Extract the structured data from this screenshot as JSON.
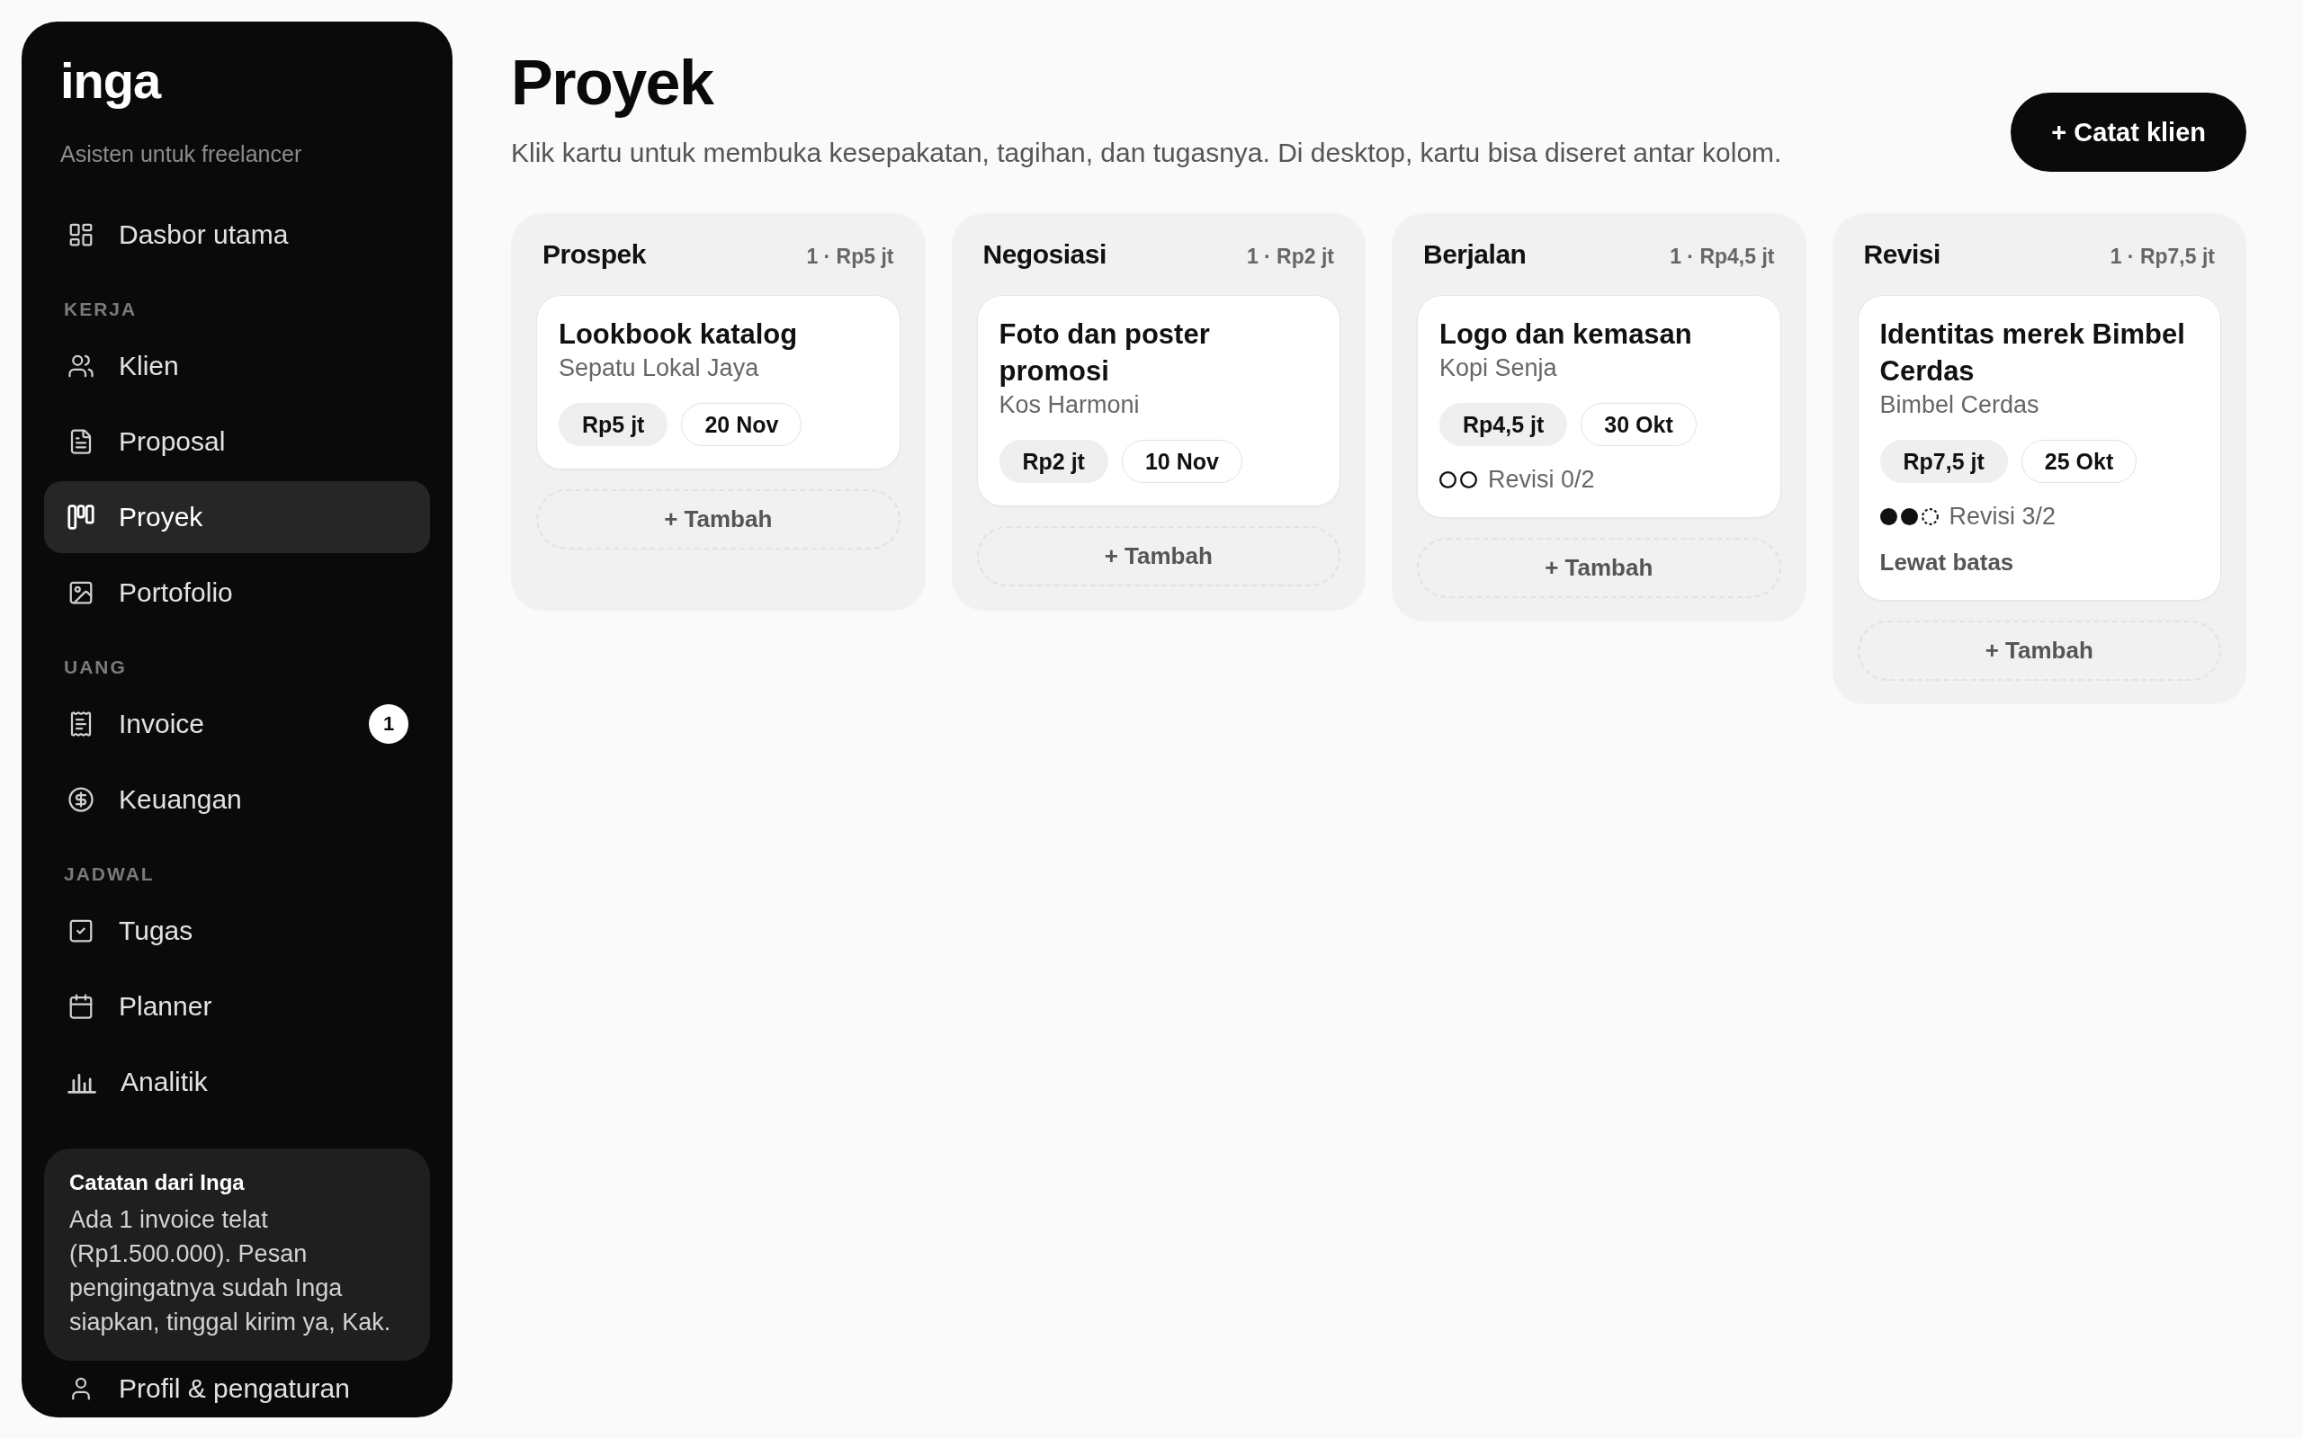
{
  "sidebar": {
    "logo": "inga",
    "tagline": "Asisten untuk freelancer",
    "groups": [
      {
        "items": [
          {
            "label": "Dasbor utama",
            "selected": false
          }
        ]
      },
      {
        "heading": "KERJA",
        "items": [
          {
            "label": "Klien",
            "selected": false
          },
          {
            "label": "Proposal",
            "selected": false
          },
          {
            "label": "Proyek",
            "selected": true
          },
          {
            "label": "Portofolio",
            "selected": false
          }
        ]
      },
      {
        "heading": "UANG",
        "items": [
          {
            "label": "Invoice",
            "selected": false,
            "badge": "1"
          },
          {
            "label": "Keuangan",
            "selected": false
          }
        ]
      },
      {
        "heading": "JADWAL",
        "items": [
          {
            "label": "Tugas",
            "selected": false
          },
          {
            "label": "Planner",
            "selected": false
          },
          {
            "label": "Analitik",
            "selected": false
          }
        ]
      }
    ],
    "note": {
      "title": "Catatan dari Inga",
      "body": "Ada 1 invoice telat (Rp1.500.000). Pesan pengingatnya sudah Inga siapkan, tinggal kirim ya, Kak."
    },
    "profile": {
      "label": "Profil & pengaturan"
    }
  },
  "header": {
    "title": "Proyek",
    "subtitle": "Klik kartu untuk membuka kesepakatan, tagihan, dan tugasnya. Di desktop, kartu bisa diseret antar kolom.",
    "action": "+ Catat klien"
  },
  "board": {
    "columns": [
      {
        "title": "Prospek",
        "summary": "1 · Rp5 jt",
        "cards": [
          {
            "title": "Lookbook katalog",
            "client": "Sepatu Lokal Jaya",
            "budget": "Rp5 jt",
            "due": "20 Nov"
          }
        ],
        "add": "+ Tambah"
      },
      {
        "title": "Negosiasi",
        "summary": "1 · Rp2 jt",
        "cards": [
          {
            "title": "Foto dan poster promosi",
            "client": "Kos Harmoni",
            "budget": "Rp2 jt",
            "due": "10 Nov"
          }
        ],
        "add": "+ Tambah"
      },
      {
        "title": "Berjalan",
        "summary": "1 · Rp4,5 jt",
        "cards": [
          {
            "title": "Logo dan kemasan",
            "client": "Kopi Senja",
            "budget": "Rp4,5 jt",
            "due": "30 Okt",
            "revision": {
              "label": "Revisi 0/2",
              "dots": [
                {
                  "kind": "free"
                },
                {
                  "kind": "free"
                }
              ]
            }
          }
        ],
        "add": "+ Tambah"
      },
      {
        "title": "Revisi",
        "summary": "1 · Rp7,5 jt",
        "cards": [
          {
            "title": "Identitas merek Bimbel Cerdas",
            "client": "Bimbel Cerdas",
            "budget": "Rp7,5 jt",
            "due": "25 Okt",
            "revision": {
              "label": "Revisi 3/2",
              "dots": [
                {
                  "kind": "used"
                },
                {
                  "kind": "used"
                },
                {
                  "kind": "extra"
                }
              ]
            },
            "warning": "Lewat batas"
          }
        ],
        "add": "+ Tambah"
      }
    ]
  }
}
